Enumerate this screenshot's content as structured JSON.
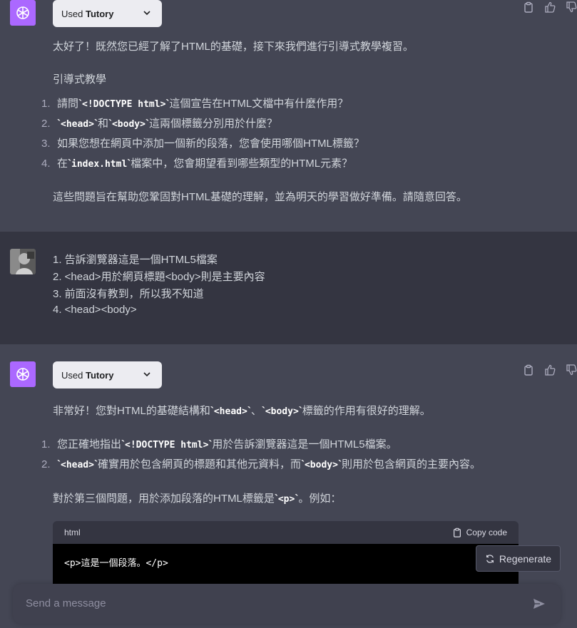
{
  "colors": {
    "assistant_bg": "#444654",
    "user_bg": "#343541",
    "avatar_purple": "#ab68ff"
  },
  "messages": [
    {
      "role": "assistant",
      "plugin": {
        "prefix": "Used ",
        "name": "Tutory"
      },
      "intro": "太好了！既然您已經了解了HTML的基礎，接下來我們進行引導式教學複習。",
      "heading": "引導式教學",
      "list": [
        {
          "num": "1.",
          "pre": "請問",
          "code": "<!DOCTYPE html>",
          "post": "這個宣告在HTML文檔中有什麼作用？"
        },
        {
          "num": "2.",
          "pre": "",
          "code": "<head>",
          "mid": "和",
          "code2": "<body>",
          "post": "這兩個標籤分別用於什麼？"
        },
        {
          "num": "3.",
          "pre": "如果您想在網頁中添加一個新的段落，您會使用哪個HTML標籤？"
        },
        {
          "num": "4.",
          "pre": "在",
          "code": "index.html",
          "post": "檔案中，您會期望看到哪些類型的HTML元素？"
        }
      ],
      "outro": "這些問題旨在幫助您鞏固對HTML基礎的理解，並為明天的學習做好準備。請隨意回答。"
    },
    {
      "role": "user",
      "lines": [
        "1. 告訴瀏覽器這是一個HTML5檔案",
        "2. <head>用於網頁標題<body>則是主要內容",
        "3. 前面沒有教到，所以我不知道",
        "4. <head><body>"
      ]
    },
    {
      "role": "assistant",
      "plugin": {
        "prefix": "Used ",
        "name": "Tutory"
      },
      "intro": {
        "pre": "非常好！您對HTML的基礎結構和",
        "code1": "<head>",
        "sep": "、",
        "code2": "<body>",
        "post": "標籤的作用有很好的理解。"
      },
      "list": [
        {
          "num": "1.",
          "pre": "您正確地指出",
          "code": "<!DOCTYPE html>",
          "post": "用於告訴瀏覽器這是一個HTML5檔案。"
        },
        {
          "num": "2.",
          "pre": "",
          "code": "<head>",
          "mid": "確實用於包含網頁的標題和其他元資料，而",
          "code2": "<body>",
          "post": "則用於包含網頁的主要內容。"
        }
      ],
      "para": {
        "pre": "對於第三個問題，用於添加段落的HTML標籤是",
        "code": "<p>",
        "post": "。例如："
      },
      "codeblock": {
        "lang": "html",
        "copy_label": "Copy code",
        "content": "<p>這是一個段落。</p>"
      }
    }
  ],
  "regenerate_label": "Regenerate",
  "composer": {
    "placeholder": "Send a message"
  },
  "icons": {
    "copy": "clipboard-icon",
    "like": "thumbs-up-icon",
    "dislike": "thumbs-down-icon",
    "regen": "refresh-icon",
    "send": "send-icon",
    "chev": "chevron-down-icon"
  }
}
